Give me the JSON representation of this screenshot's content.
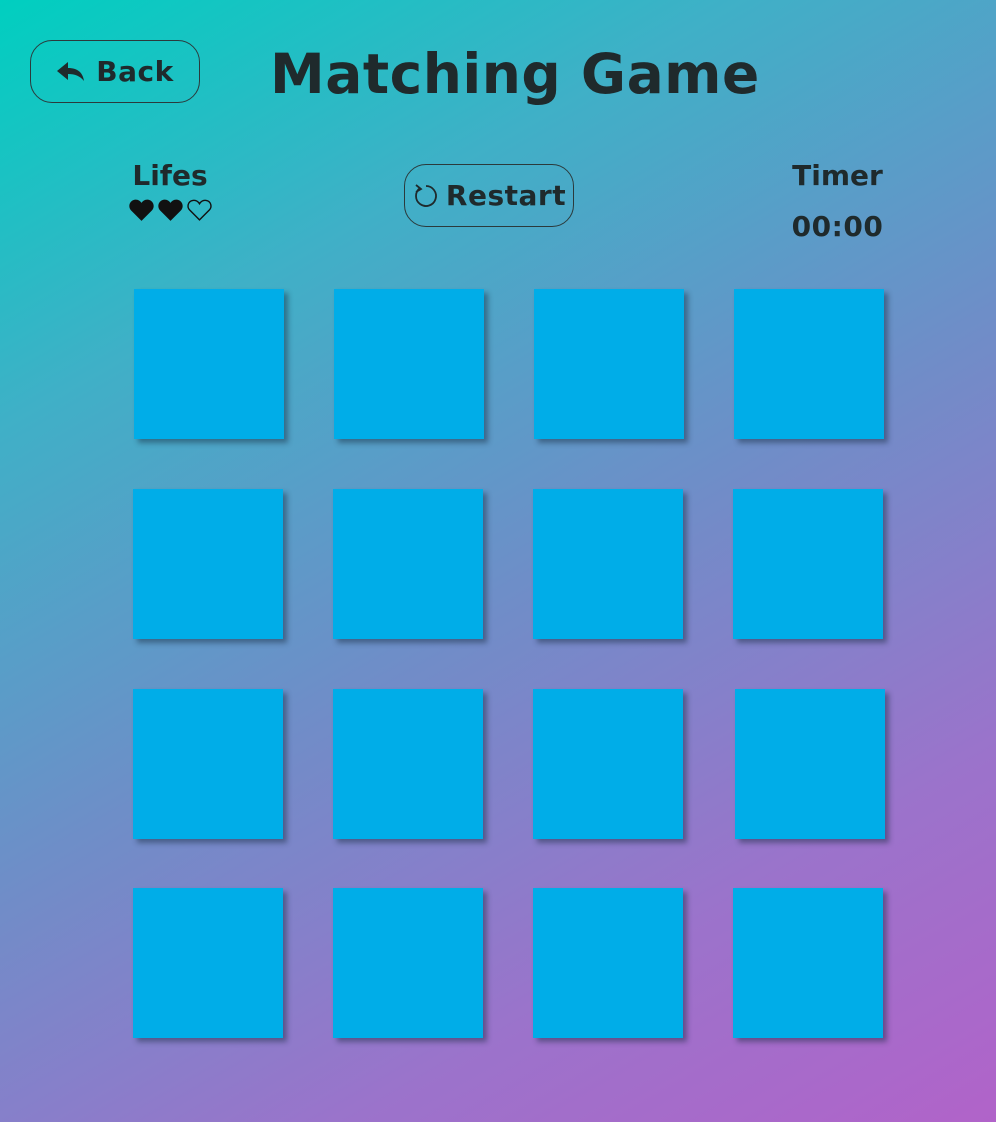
{
  "header": {
    "back_label": "Back",
    "back_icon": "reply-arrow-icon",
    "title": "Matching Game"
  },
  "status": {
    "lifes_label": "Lifes",
    "lives_total": 3,
    "lives_remaining": 2,
    "heart_filled_icon": "heart-filled-icon",
    "heart_empty_icon": "heart-outline-icon",
    "restart_label": "Restart",
    "restart_icon": "refresh-icon",
    "timer_label": "Timer",
    "timer_value": "00:00"
  },
  "board": {
    "rows": 4,
    "columns": 4,
    "card_back_color": "#00ade8",
    "cards_face_down": 16
  },
  "colors": {
    "gradient_start": "#00cfc0",
    "gradient_end": "#b163c9",
    "text": "#1f2a2c"
  }
}
